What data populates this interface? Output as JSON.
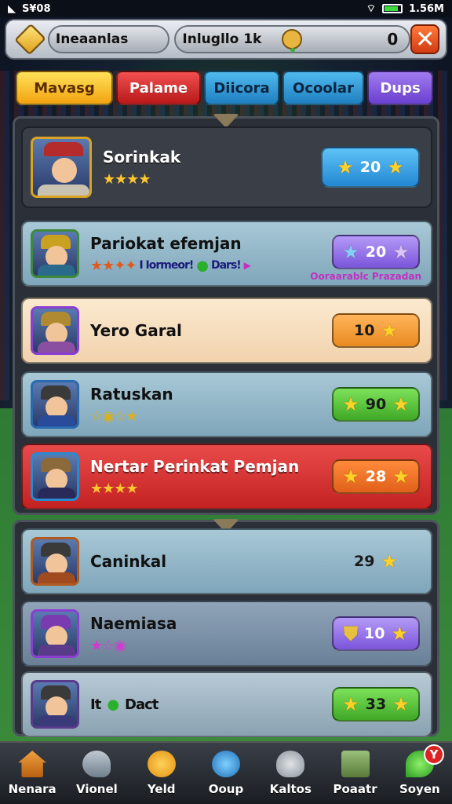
{
  "status_bar": {
    "left_text": "S¥08",
    "right_text": "1.56M"
  },
  "top_bar": {
    "player_label": "Ineaanlas",
    "middle_label": "Inlugllo 1k",
    "counter_value": "0",
    "close_label": "✕"
  },
  "tabs": [
    {
      "label": "Mavasg",
      "active": true
    },
    {
      "label": "Palame"
    },
    {
      "label": "Diicora"
    },
    {
      "label": "Ocoolar"
    },
    {
      "label": "Dups"
    }
  ],
  "featured": {
    "name": "Sorinkak",
    "stars": "★★★★",
    "button_value": "20"
  },
  "list1": [
    {
      "name": "Pariokat efemjan",
      "stars": "★★✦✦",
      "sub1": "I Iormeor!",
      "sub2": "Dars!",
      "button_value": "20",
      "note": "Ooraarablc Prazadan",
      "style": "blue"
    },
    {
      "name": "Yero Garal",
      "stars": "",
      "button_value": "10",
      "style": "cream"
    },
    {
      "name": "Ratuskan",
      "stars": "☆◉☆★",
      "button_value": "90",
      "style": "blue"
    },
    {
      "name": "Nertar Perinkat Pemjan",
      "stars": "★★★★",
      "button_value": "28",
      "style": "red"
    }
  ],
  "list2": [
    {
      "name": "Caninkal",
      "button_value": "29",
      "style": "blue"
    },
    {
      "name": "Naemiasa",
      "stars": "★☆◉",
      "button_value": "10",
      "style": "slate"
    },
    {
      "name": "Dact",
      "prefix": "It",
      "button_value": "33",
      "style": "light"
    }
  ],
  "nav": [
    {
      "label": "Nenara",
      "icon": "house-icon"
    },
    {
      "label": "Vionel",
      "icon": "whistle-icon"
    },
    {
      "label": "Yeld",
      "icon": "face-icon"
    },
    {
      "label": "Ooup",
      "icon": "cup-icon"
    },
    {
      "label": "Kaltos",
      "icon": "skull-icon"
    },
    {
      "label": "Poaatr",
      "icon": "chest-icon"
    },
    {
      "label": "Soyen",
      "icon": "leaf-icon",
      "badge": "Y"
    }
  ],
  "colors": {
    "accent": "#f2a30f",
    "card_blue": "#8fb4c6",
    "card_red": "#d63030",
    "card_cream": "#f6dfbf"
  }
}
